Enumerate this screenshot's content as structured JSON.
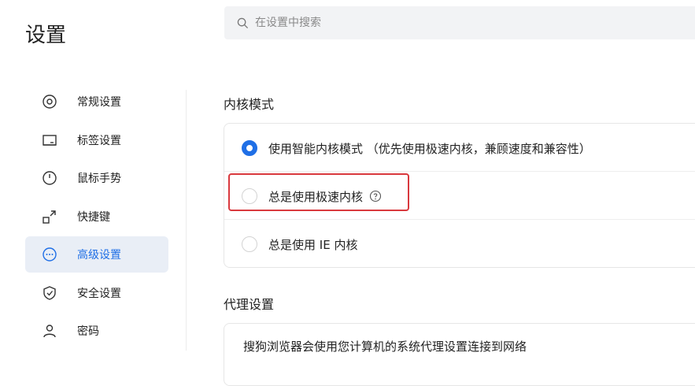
{
  "header": {
    "title": "设置",
    "search_placeholder": "在设置中搜索"
  },
  "sidebar": {
    "items": [
      {
        "label": "常规设置",
        "icon": "general-settings-icon",
        "active": false
      },
      {
        "label": "标签设置",
        "icon": "tab-icon",
        "active": false
      },
      {
        "label": "鼠标手势",
        "icon": "mouse-icon",
        "active": false
      },
      {
        "label": "快捷键",
        "icon": "shortcut-icon",
        "active": false
      },
      {
        "label": "高级设置",
        "icon": "more-icon",
        "active": true
      },
      {
        "label": "安全设置",
        "icon": "shield-icon",
        "active": false
      },
      {
        "label": "密码",
        "icon": "user-icon",
        "active": false
      }
    ]
  },
  "kernel": {
    "section_title": "内核模式",
    "options": [
      {
        "label": "使用智能内核模式 （优先使用极速内核，兼顾速度和兼容性）",
        "checked": true
      },
      {
        "label": "总是使用极速内核",
        "checked": false,
        "has_help": true
      },
      {
        "label": "总是使用 IE 内核",
        "checked": false
      }
    ]
  },
  "proxy": {
    "section_title": "代理设置",
    "description": "搜狗浏览器会使用您计算机的系统代理设置连接到网络"
  },
  "colors": {
    "accent": "#1f6fe6",
    "highlight": "#d9393e",
    "active_bg": "#e9eef6"
  }
}
